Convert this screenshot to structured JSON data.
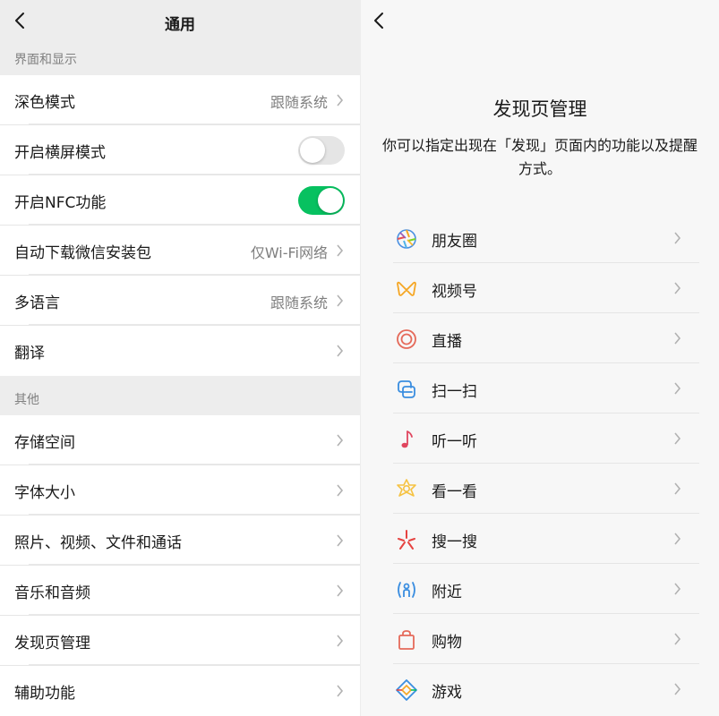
{
  "left": {
    "title": "通用",
    "section_display": "界面和显示",
    "section_other": "其他",
    "display_rows": [
      {
        "label": "深色模式",
        "value": "跟随系统"
      },
      {
        "label": "开启横屏模式"
      },
      {
        "label": "开启NFC功能"
      },
      {
        "label": "自动下载微信安装包",
        "value": "仅Wi-Fi网络"
      },
      {
        "label": "多语言",
        "value": "跟随系统"
      },
      {
        "label": "翻译"
      }
    ],
    "landscape_enabled": false,
    "nfc_enabled": true,
    "other_rows": [
      {
        "label": "存储空间"
      },
      {
        "label": "字体大小"
      },
      {
        "label": "照片、视频、文件和通话"
      },
      {
        "label": "音乐和音频"
      },
      {
        "label": "发现页管理"
      },
      {
        "label": "辅助功能"
      }
    ]
  },
  "right": {
    "title": "发现页管理",
    "description": "你可以指定出现在「发现」页面内的功能以及提醒方式。",
    "items": [
      {
        "label": "朋友圈",
        "icon": "moments-icon"
      },
      {
        "label": "视频号",
        "icon": "channels-icon"
      },
      {
        "label": "直播",
        "icon": "live-icon"
      },
      {
        "label": "扫一扫",
        "icon": "scan-icon"
      },
      {
        "label": "听一听",
        "icon": "music-note-icon"
      },
      {
        "label": "看一看",
        "icon": "top-stories-icon"
      },
      {
        "label": "搜一搜",
        "icon": "search-sparkle-icon"
      },
      {
        "label": "附近",
        "icon": "nearby-icon"
      },
      {
        "label": "购物",
        "icon": "shopping-bag-icon"
      },
      {
        "label": "游戏",
        "icon": "game-icon"
      }
    ]
  },
  "colors": {
    "accent_green": "#07c160",
    "background": "#ededed"
  }
}
